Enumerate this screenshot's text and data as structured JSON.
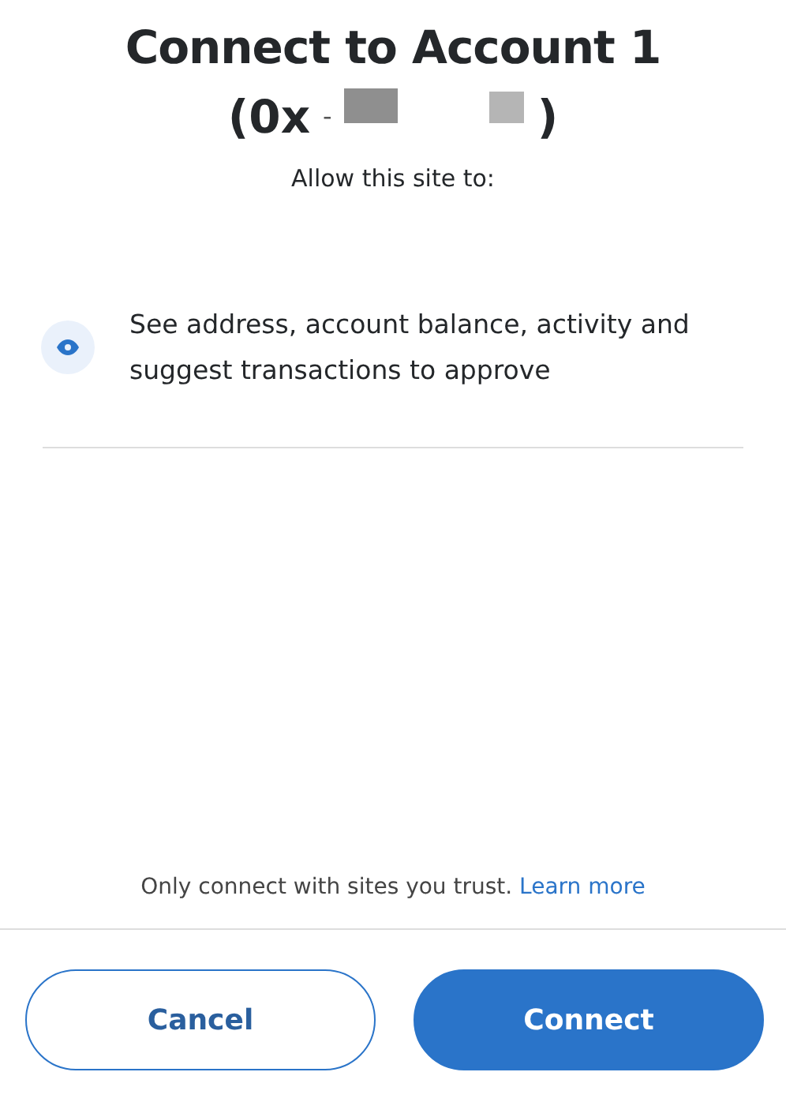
{
  "title": "Connect to Account 1",
  "address": {
    "open": "(0x",
    "dash": "-",
    "close": ")"
  },
  "subtitle": "Allow this site to:",
  "permissions": [
    {
      "kind": "view",
      "text": "See address, account balance, activity and suggest transactions to approve"
    }
  ],
  "footer": {
    "note": "Only connect with sites you trust.",
    "link": "Learn more"
  },
  "buttons": [
    {
      "kind": "secondary",
      "label": "Cancel"
    },
    {
      "kind": "primary",
      "label": "Connect"
    }
  ]
}
